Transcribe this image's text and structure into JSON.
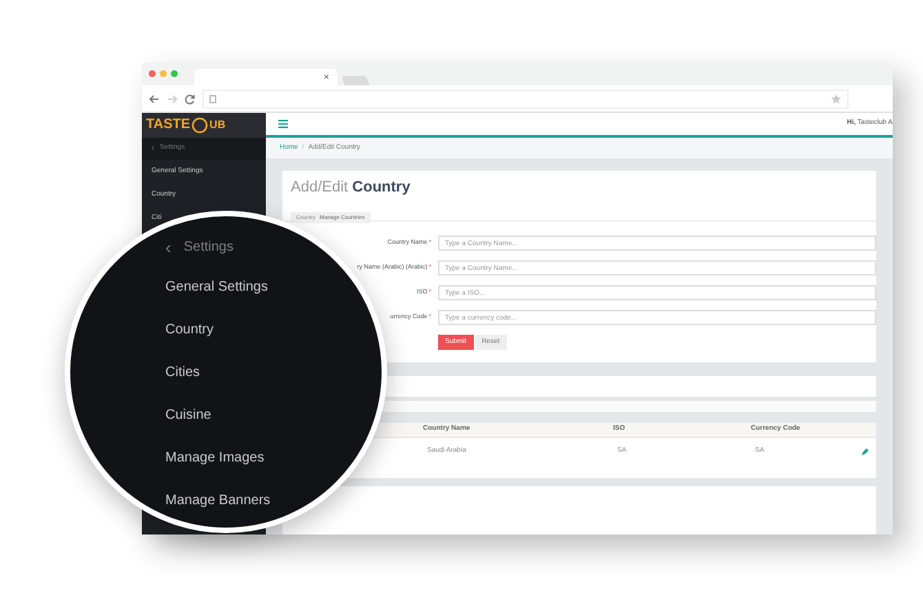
{
  "browser": {
    "tab_close": "×"
  },
  "sidebar": {
    "logo_left": "TASTE",
    "logo_right": "UB",
    "back_icon": "‹",
    "back_label": "Settings",
    "items": [
      "General Settings",
      "Country",
      "Citi"
    ]
  },
  "header": {
    "greeting": "**Hi,** Tasteclub A"
  },
  "breadcrumb": [
    "Home",
    "Add/Edit Country"
  ],
  "breadcrumb_separator": "/",
  "page": {
    "title_light": "Add/Edit",
    "title_bold": "Country",
    "chip": [
      "Country",
      "Manage Countries"
    ]
  },
  "form": {
    "fields": [
      {
        "label": "Country Name",
        "required_mark": "*",
        "placeholder": "Type a Country Name..."
      },
      {
        "label": "ry Name (Arabic) (Arabic)",
        "required_mark": "*",
        "placeholder": "Type a Country Name..."
      },
      {
        "label": "ISO",
        "required_mark": "*",
        "placeholder": "Type a ISO..."
      },
      {
        "label": "urrency Code",
        "required_mark": "*",
        "placeholder": "Type a currency code..."
      }
    ],
    "buttons": [
      {
        "label": "Submit",
        "kind": "primary"
      },
      {
        "label": "Reset",
        "kind": "default"
      }
    ]
  },
  "table": {
    "columns": [
      "Country Name",
      "ISO",
      "Currency Code"
    ],
    "rows": [
      {
        "cells": [
          "Saudi Arabia",
          "SA",
          "SA"
        ]
      }
    ]
  },
  "magnifier": {
    "back_icon": "‹",
    "back_label": "Settings",
    "items": [
      "General Settings",
      "Country",
      "Cities",
      "Cuisine",
      "Manage Images",
      "Manage Banners"
    ]
  }
}
